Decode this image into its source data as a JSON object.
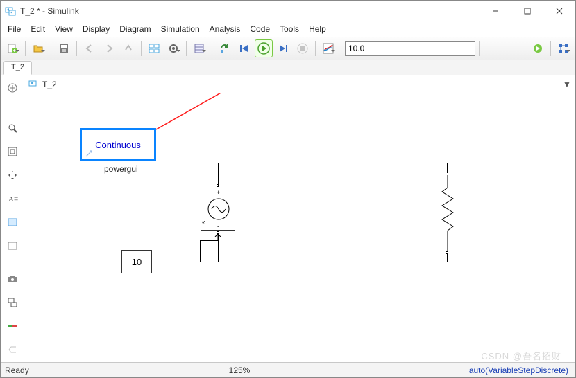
{
  "window": {
    "title": "T_2 * - Simulink"
  },
  "menu": {
    "items": [
      "File",
      "Edit",
      "View",
      "Display",
      "Diagram",
      "Simulation",
      "Analysis",
      "Code",
      "Tools",
      "Help"
    ]
  },
  "toolbar": {
    "stop_time": "10.0"
  },
  "tabs": {
    "active": "T_2"
  },
  "breadcrumb": {
    "path": "T_2"
  },
  "canvas": {
    "powergui": {
      "text": "Continuous",
      "label": "powergui"
    },
    "constant": {
      "value": "10"
    }
  },
  "status": {
    "left": "Ready",
    "mid": "125%",
    "right": "auto(VariableStepDiscrete)"
  },
  "watermark": "CSDN @吾名招财"
}
